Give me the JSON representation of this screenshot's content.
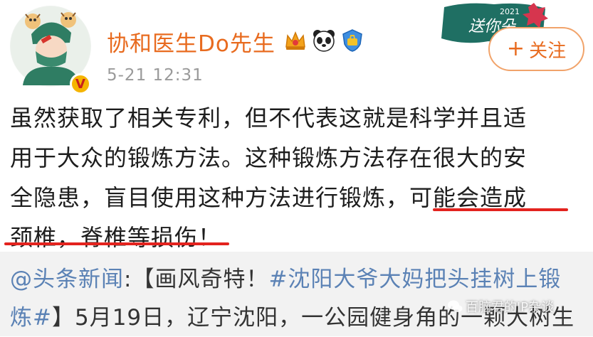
{
  "post": {
    "username": "协和医生Do先生",
    "timestamp": "5-21 12:31",
    "follow_label": "关注",
    "follow_plus": "+",
    "verified_mark": "V",
    "badges": [
      "crown-badge-icon",
      "panda-badge-icon",
      "shield-badge-icon"
    ],
    "deco_text": "2021",
    "deco_script": "送你朵",
    "body_lines": [
      "虽然获取了相关专利，但不代表这就是科学并且适",
      "用于大众的锻炼方法。这种锻炼方法存在很大的安",
      "全隐患，盲目使用这种方法进行锻炼，可能会造成",
      "颈椎，脊椎等损伤！"
    ]
  },
  "repost": {
    "mention": "@头条新闻",
    "colon": ":",
    "bracket_open": "【画风奇特！",
    "hashtag_part1": "#沈阳大爷大妈把头挂树上锻",
    "hashtag_part2": "炼#",
    "line2_rest": "】5月19日，辽宁沈阳，一公园健身角的一颗大树生"
  },
  "watermark": {
    "text": "百脑君的IP杂谈"
  },
  "colors": {
    "username": "#e86b1f",
    "link": "#5b82b5",
    "underline": "#e3231e",
    "repost_bg": "#f2f2f2"
  }
}
